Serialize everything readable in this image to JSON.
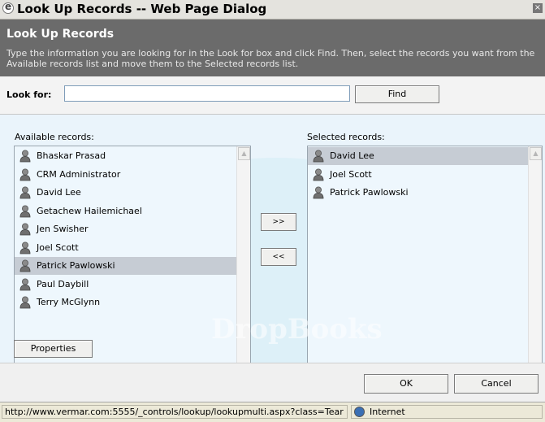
{
  "window": {
    "title": "Look Up Records -- Web Page Dialog",
    "close_glyph": "×"
  },
  "header": {
    "title": "Look Up Records",
    "description": "Type the information you are looking for in the Look for box and click Find. Then, select the records you want from the Available records list and move them to the Selected records list."
  },
  "search": {
    "label": "Look for:",
    "value": "",
    "find_label": "Find"
  },
  "available": {
    "label": "Available records:",
    "items": [
      {
        "name": "Bhaskar Prasad",
        "selected": false
      },
      {
        "name": "CRM Administrator",
        "selected": false
      },
      {
        "name": "David Lee",
        "selected": false
      },
      {
        "name": "Getachew Hailemichael",
        "selected": false
      },
      {
        "name": "Jen Swisher",
        "selected": false
      },
      {
        "name": "Joel Scott",
        "selected": false
      },
      {
        "name": "Patrick Pawlowski",
        "selected": true
      },
      {
        "name": "Paul Daybill",
        "selected": false
      },
      {
        "name": "Terry McGlynn",
        "selected": false
      }
    ]
  },
  "selected_list": {
    "label": "Selected records:",
    "items": [
      {
        "name": "David Lee",
        "selected": true
      },
      {
        "name": "Joel Scott",
        "selected": false
      },
      {
        "name": "Patrick Pawlowski",
        "selected": false
      }
    ]
  },
  "move": {
    "add_label": ">>",
    "remove_label": "<<"
  },
  "properties_label": "Properties",
  "footer": {
    "ok_label": "OK",
    "cancel_label": "Cancel"
  },
  "statusbar": {
    "url": "http://www.vermar.com:5555/_controls/lookup/lookupmulti.aspx?class=Tear",
    "zone": "Internet"
  },
  "watermark": "DropBooks",
  "colors": {
    "header_bg": "#6b6b6b",
    "list_bg": "#eef7fd",
    "selection": "#c6ccd4"
  },
  "icons": {
    "record": "user-icon",
    "browser": "ie-icon",
    "zone": "globe-icon"
  }
}
